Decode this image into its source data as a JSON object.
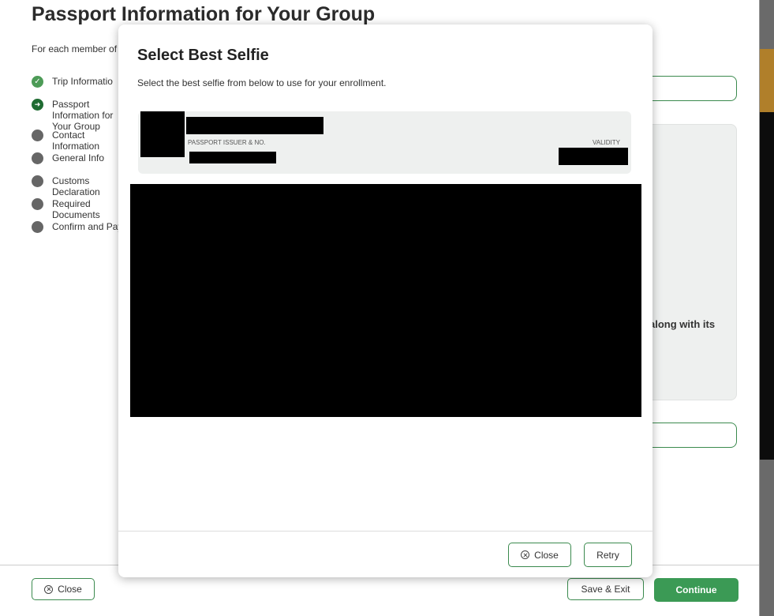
{
  "page": {
    "title": "Passport Information for Your Group",
    "subtitle": "For each member of",
    "steps": [
      {
        "label": "Trip Informatio",
        "status": "done",
        "icon": "check-icon"
      },
      {
        "label": "Passport Information for Your Group",
        "status": "current",
        "icon": "arrow-right-icon"
      },
      {
        "label": "Contact Information",
        "status": "pending",
        "icon": "dot-icon"
      },
      {
        "label": "General Info",
        "status": "pending",
        "icon": "dot-icon"
      },
      {
        "label": "Customs Declaration",
        "status": "pending",
        "icon": "dot-icon"
      },
      {
        "label": "Required Documents",
        "status": "pending",
        "icon": "dot-icon"
      },
      {
        "label": "Confirm and Pay",
        "status": "pending",
        "icon": "dot-icon"
      }
    ],
    "right_panel_text": "along with its",
    "footer": {
      "close_label": "Close",
      "save_exit_label": "Save & Exit",
      "continue_label": "Continue"
    }
  },
  "modal": {
    "title": "Select Best Selfie",
    "subtitle": "Select the best selfie from below to use for your enrollment.",
    "card": {
      "issuer_label": "PASSPORT ISSUER & NO.",
      "validity_label": "VALIDITY"
    },
    "close_label": "Close",
    "retry_label": "Retry"
  },
  "colors": {
    "accent": "#3b9a55",
    "border_green": "#3b8a4e",
    "step_done": "#4d9b57",
    "step_current": "#1f6b32",
    "step_pending": "#666666"
  }
}
